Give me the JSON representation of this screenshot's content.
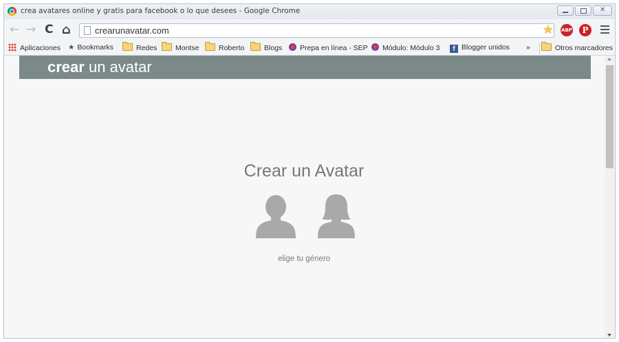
{
  "window": {
    "title": "crea avatares online y gratis para facebook o lo que desees - Google Chrome"
  },
  "toolbar": {
    "back_icon": "←",
    "forward_icon": "→",
    "reload_icon": "C",
    "home_icon": "⌂",
    "url": "crearunavatar.com",
    "bookmark_star": "★",
    "abp_label": "ABP",
    "pinterest_label": "P"
  },
  "bookmarks": {
    "items": [
      {
        "label": "Aplicaciones",
        "icon": "apps-grid-icon"
      },
      {
        "label": "Bookmarks",
        "icon": "star-icon"
      },
      {
        "label": "Redes",
        "icon": "folder-icon"
      },
      {
        "label": "Montse",
        "icon": "folder-icon"
      },
      {
        "label": "Roberto",
        "icon": "folder-icon"
      },
      {
        "label": "Blogs",
        "icon": "folder-icon"
      },
      {
        "label": "Prepa en línea - SEP",
        "icon": "sep-icon"
      },
      {
        "label": "Módulo: Módulo 3",
        "icon": "sep-icon"
      },
      {
        "label": "Blogger unidos",
        "icon": "facebook-icon"
      }
    ],
    "overflow": "»",
    "other": "Otros marcadores"
  },
  "site": {
    "logo_bold": "crear",
    "logo_rest": " un avatar",
    "heading": "Crear un Avatar",
    "caption": "elige tu género",
    "avatar_color": "#a9a9a9",
    "header_color": "#7b8a89"
  }
}
